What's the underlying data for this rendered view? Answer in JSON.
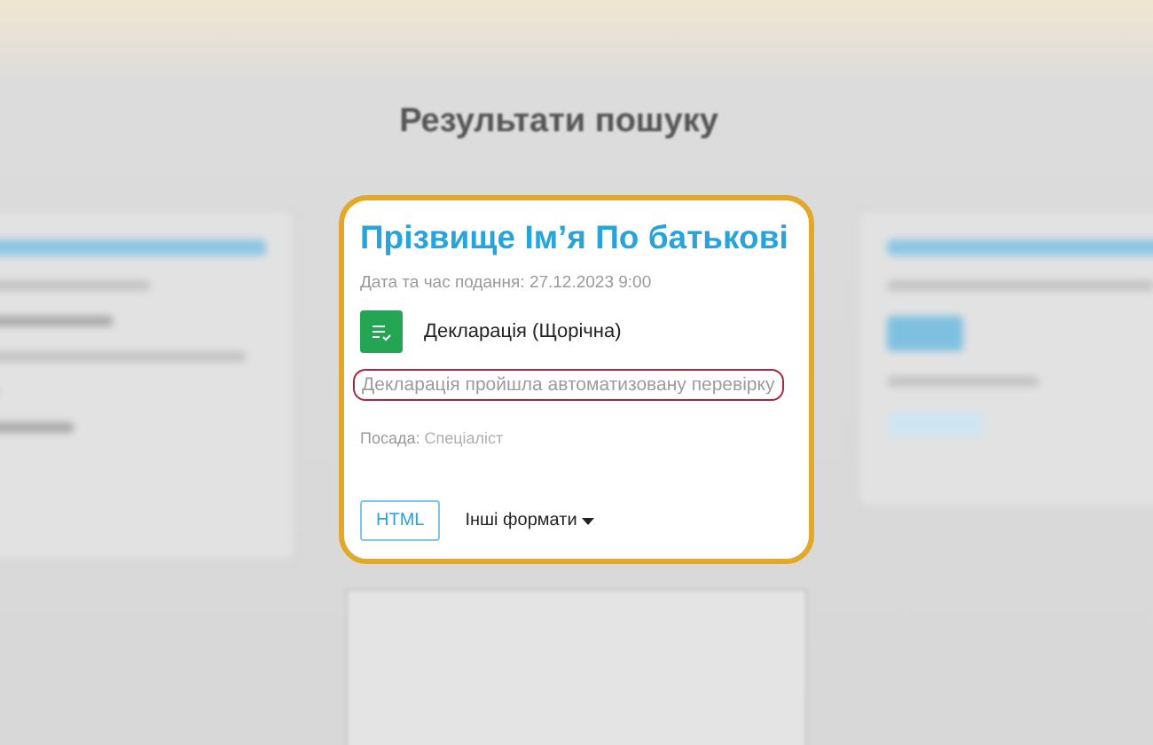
{
  "heading": "Результати пошуку",
  "card": {
    "title": "Прізвище Ім’я По батькові",
    "date_label": "Дата та час подання:",
    "date": "27.12.2023 9:00",
    "document_type": "Декларація (Щорічна)",
    "status": {
      "text": "Декларація пройшла автоматизовану перевірку",
      "highlighted": true
    },
    "position_label": "Посада:",
    "position": "Спеціаліст",
    "format_button": "HTML",
    "formats_menu": "Інші формати"
  }
}
